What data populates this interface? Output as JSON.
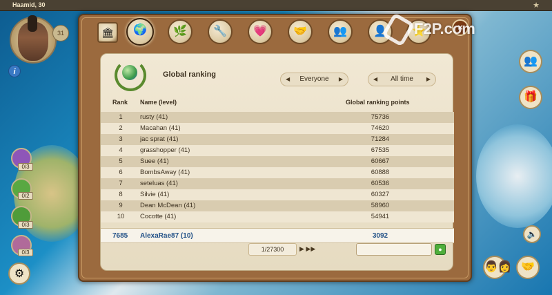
{
  "hud": {
    "player": "Haamid, 30",
    "level_badge": "31",
    "info": "i",
    "resources": [
      "0/3",
      "0/2",
      "0/3",
      "0/3"
    ]
  },
  "icons": {
    "tabs": [
      "chest-icon",
      "globe-icon",
      "leaf-icon",
      "tools-icon",
      "heart-icon",
      "handshake-icon",
      "friends-icon",
      "profile-icon",
      "star-icon"
    ],
    "right_buttons": [
      "friends-icon",
      "gift-icon",
      "sound-icon",
      "handshake-icon"
    ]
  },
  "panel": {
    "title": "Global ranking",
    "filter_scope": "Everyone",
    "filter_time": "All time",
    "headers": {
      "rank": "Rank",
      "name": "Name (level)",
      "points": "Global ranking points"
    },
    "rows": [
      {
        "rank": "1",
        "name": "rusty (41)",
        "points": "75736"
      },
      {
        "rank": "2",
        "name": "Macahan (41)",
        "points": "74620"
      },
      {
        "rank": "3",
        "name": "jac sprat (41)",
        "points": "71284"
      },
      {
        "rank": "4",
        "name": "grasshopper (41)",
        "points": "67535"
      },
      {
        "rank": "5",
        "name": "Suee (41)",
        "points": "60667"
      },
      {
        "rank": "6",
        "name": "BombsAway (41)",
        "points": "60888"
      },
      {
        "rank": "7",
        "name": "seteluas (41)",
        "points": "60536"
      },
      {
        "rank": "8",
        "name": "Silvie (41)",
        "points": "60327"
      },
      {
        "rank": "9",
        "name": "Dean McDean (41)",
        "points": "58960"
      },
      {
        "rank": "10",
        "name": "Cocotte (41)",
        "points": "54941"
      }
    ],
    "me": {
      "rank": "7685",
      "name": "AlexaRae87 (10)",
      "points": "3092"
    },
    "pager": "1/27300",
    "search_value": ""
  },
  "watermark": "F2P.com",
  "colors": {
    "accent": "#1f4f86",
    "frame": "#9b6a3e",
    "panel": "#f1e8d4"
  }
}
